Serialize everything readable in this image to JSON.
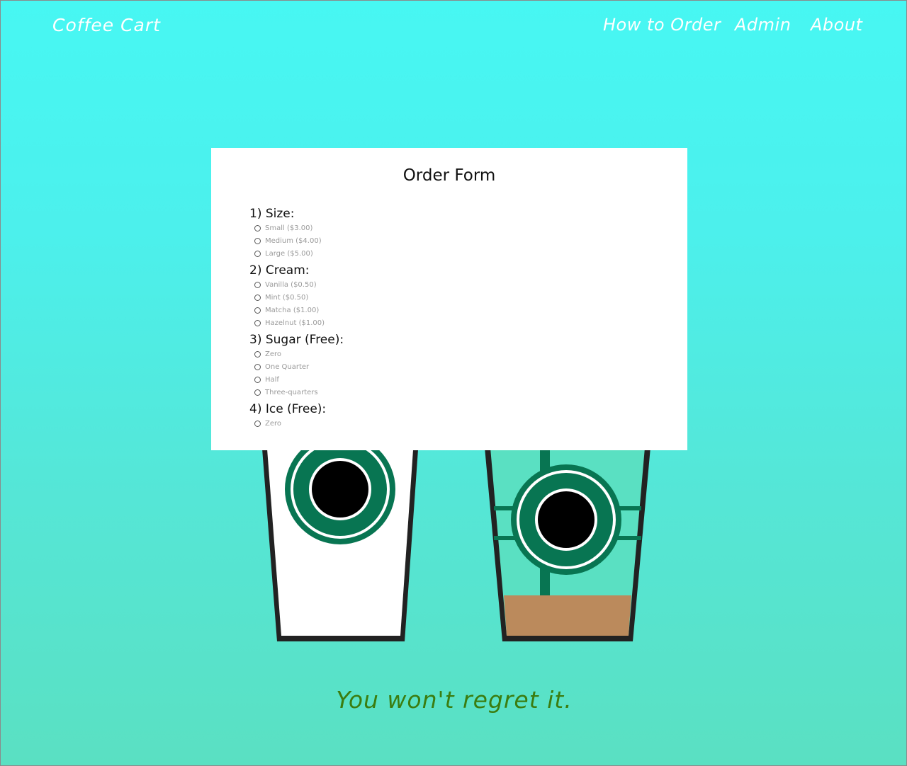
{
  "nav": {
    "brand": "Coffee Cart",
    "links": [
      "How to Order",
      "Admin",
      "About"
    ]
  },
  "form": {
    "title": "Order Form",
    "questions": [
      {
        "title": "1) Size:",
        "options": [
          "Small ($3.00)",
          "Medium ($4.00)",
          "Large ($5.00)"
        ]
      },
      {
        "title": "2) Cream:",
        "options": [
          "Vanilla ($0.50)",
          "Mint ($0.50)",
          "Matcha ($1.00)",
          "Hazelnut ($1.00)"
        ]
      },
      {
        "title": "3) Sugar (Free):",
        "options": [
          "Zero",
          "One Quarter",
          "Half",
          "Three-quarters"
        ]
      },
      {
        "title": "4) Ice (Free):",
        "options": [
          "Zero"
        ]
      }
    ]
  },
  "tagline": "You won't regret it.",
  "colors": {
    "bg_top": "#47f7f3",
    "bg_bottom": "#5ae0c2",
    "logo_green": "#087552",
    "coffee": "#bb8a5c",
    "tagline": "#3b7d10"
  }
}
